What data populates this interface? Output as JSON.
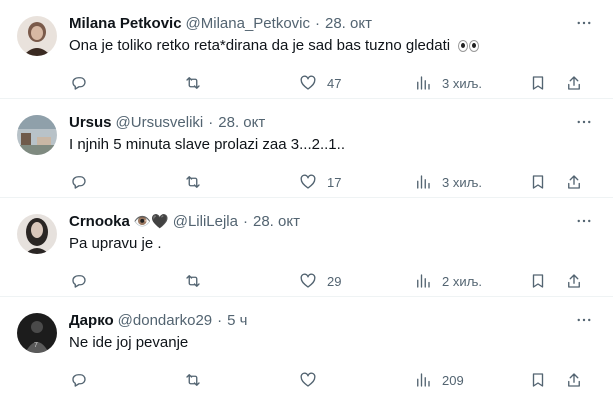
{
  "tweets": [
    {
      "name": "Milana Petkovic",
      "handle": "@Milana_Petkovic",
      "dot": "·",
      "time": "28. окт",
      "text": "Ona je toliko retko reta*dirana da je sad bas tuzno gledati",
      "text_emoji": "eyes-emoji",
      "replies": "",
      "retweets": "",
      "likes": "47",
      "views": "3 хиљ.",
      "avatar_colors": [
        "#7a5a4a",
        "#3a2a22"
      ]
    },
    {
      "name": "Ursus",
      "handle": "@Ursusveliki",
      "dot": "·",
      "time": "28. окт",
      "text": "I njnih 5 minuta slave prolazi zaa 3...2..1..",
      "replies": "",
      "retweets": "",
      "likes": "17",
      "views": "3 хиљ.",
      "avatar_colors": [
        "#9aa7b0",
        "#5b6a72"
      ]
    },
    {
      "name": "Crnooka",
      "name_emoji": "👁️🖤",
      "handle": "@LiliLejla",
      "dot": "·",
      "time": "28. окт",
      "text": "Pa upravu je .",
      "replies": "",
      "retweets": "",
      "likes": "29",
      "views": "2 хиљ.",
      "avatar_colors": [
        "#2a2624",
        "#d9c7bb"
      ]
    },
    {
      "name": "Дарко",
      "handle": "@dondarko29",
      "dot": "·",
      "time": "5 ч",
      "text": "Ne ide joj pevanje",
      "replies": "",
      "retweets": "",
      "likes": "",
      "views": "209",
      "avatar_colors": [
        "#1c1c1c",
        "#5a5a5a"
      ]
    }
  ],
  "icons": {
    "reply": "reply-icon",
    "retweet": "retweet-icon",
    "like": "heart-icon",
    "views": "views-icon",
    "bookmark": "bookmark-icon",
    "share": "share-icon",
    "more": "more-icon"
  },
  "colors": {
    "text": "#0f1419",
    "secondary": "#536471",
    "divider": "#eff3f4"
  }
}
